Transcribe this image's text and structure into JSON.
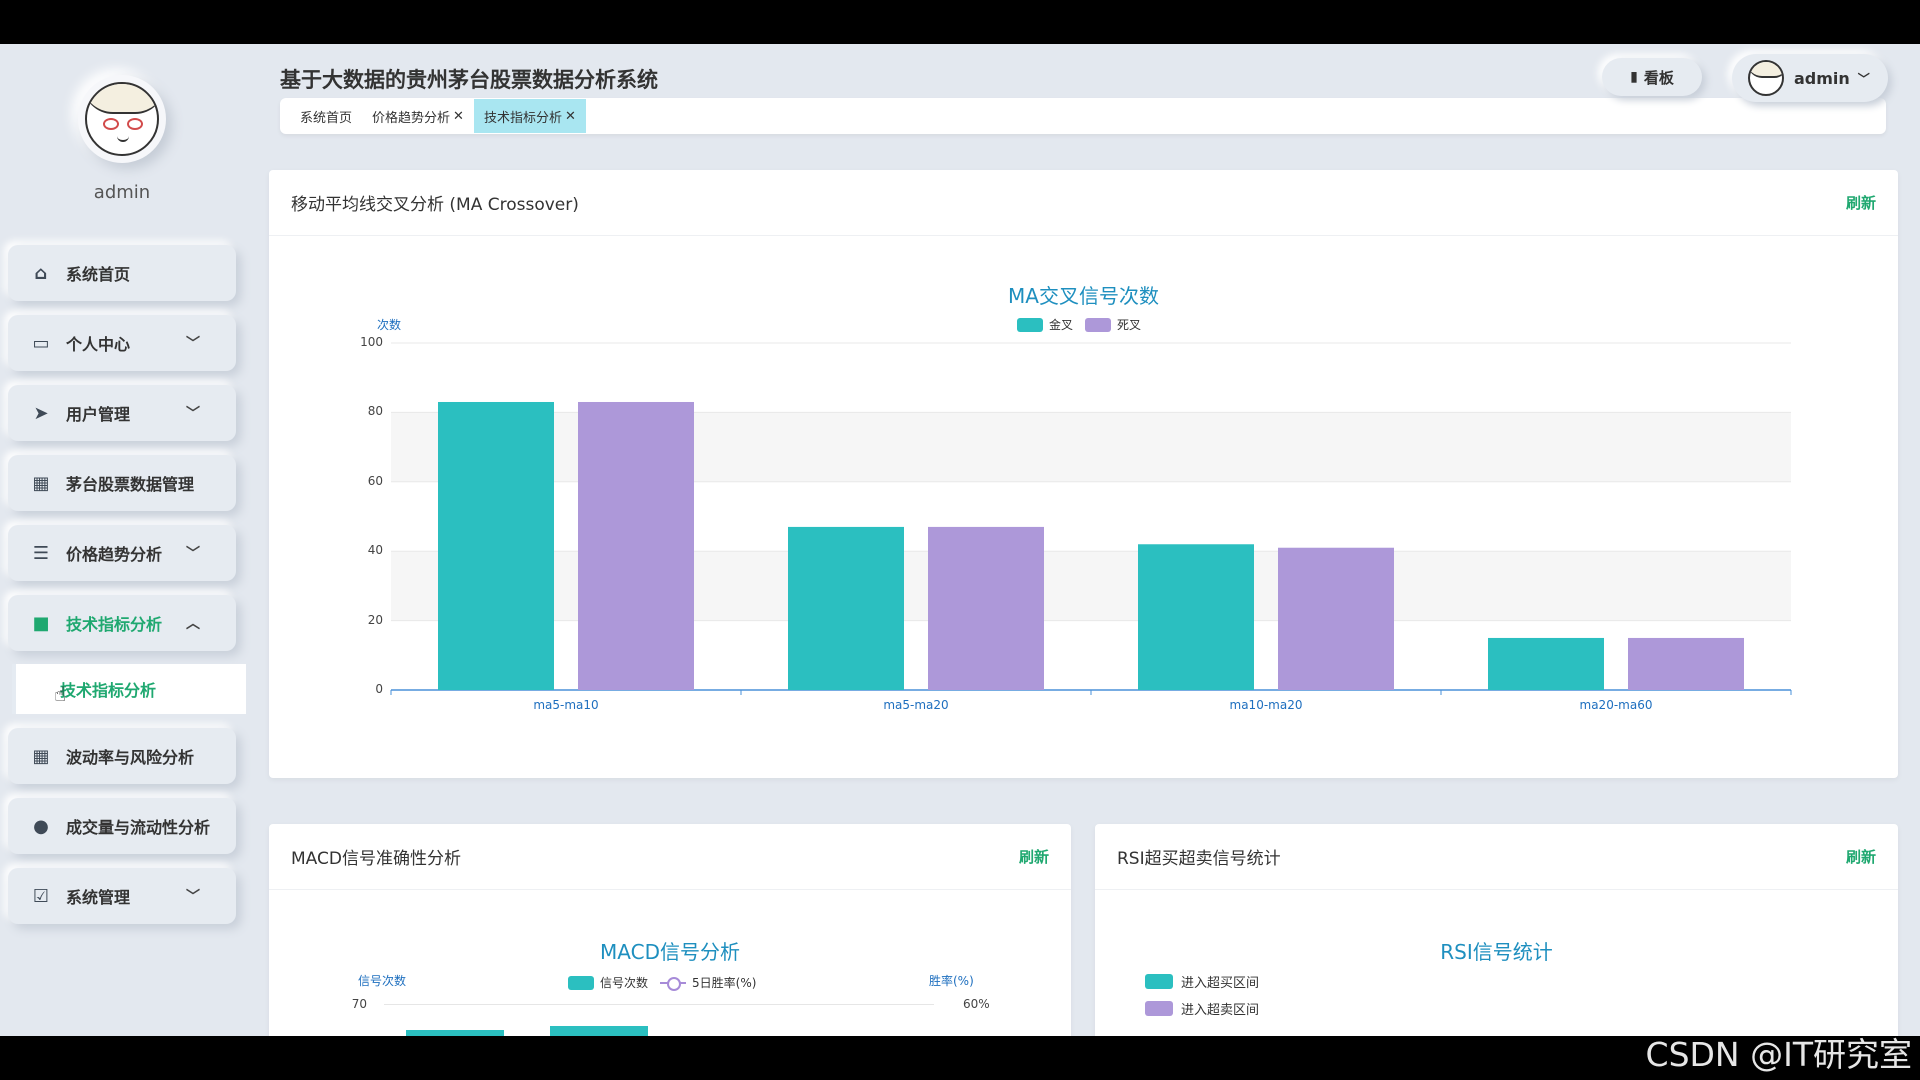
{
  "app": {
    "title": "基于大数据的贵州茅台股票数据分析系统"
  },
  "sidebar": {
    "username": "admin",
    "items": [
      {
        "label": "系统首页",
        "icon": "home-icon",
        "expandable": false
      },
      {
        "label": "个人中心",
        "icon": "id-card-icon",
        "expandable": true
      },
      {
        "label": "用户管理",
        "icon": "send-icon",
        "expandable": true
      },
      {
        "label": "茅台股票数据管理",
        "icon": "grid-icon",
        "expandable": false
      },
      {
        "label": "价格趋势分析",
        "icon": "sliders-icon",
        "expandable": true
      },
      {
        "label": "技术指标分析",
        "icon": "briefcase-icon",
        "expandable": true,
        "expanded": true,
        "active": true
      },
      {
        "label": "波动率与风险分析",
        "icon": "grid-icon",
        "expandable": false
      },
      {
        "label": "成交量与流动性分析",
        "icon": "user-icon",
        "expandable": false
      },
      {
        "label": "系统管理",
        "icon": "clipboard-check-icon",
        "expandable": true
      }
    ],
    "submenu": {
      "label": "技术指标分析"
    }
  },
  "header": {
    "tabs": [
      {
        "label": "系统首页",
        "closable": false
      },
      {
        "label": "价格趋势分析",
        "closable": true
      },
      {
        "label": "技术指标分析",
        "closable": true,
        "active": true
      }
    ],
    "dashboard_label": "看板",
    "user_label": "admin"
  },
  "cards": {
    "ma": {
      "title": "移动平均线交叉分析 (MA Crossover)",
      "refresh": "刷新"
    },
    "macd": {
      "title": "MACD信号准确性分析",
      "refresh": "刷新"
    },
    "rsi": {
      "title": "RSI超买超卖信号统计",
      "refresh": "刷新"
    }
  },
  "chart_data": [
    {
      "type": "bar",
      "title": "MA交叉信号次数",
      "ylabel": "次数",
      "xlabel": "",
      "categories": [
        "ma5-ma10",
        "ma5-ma20",
        "ma10-ma20",
        "ma20-ma60"
      ],
      "series": [
        {
          "name": "金叉",
          "color": "#2bbfc0",
          "values": [
            83,
            47,
            42,
            15
          ]
        },
        {
          "name": "死叉",
          "color": "#ad98d9",
          "values": [
            83,
            47,
            41,
            15
          ]
        }
      ],
      "ylim": [
        0,
        100
      ],
      "yticks": [
        0,
        20,
        40,
        60,
        80,
        100
      ],
      "grid": true,
      "legend": "top-center"
    },
    {
      "type": "bar",
      "title": "MACD信号分析",
      "ylabel": "信号次数",
      "y2label": "胜率(%)",
      "series": [
        {
          "name": "信号次数",
          "color": "#2bbfc0"
        },
        {
          "name": "5日胜率(%)",
          "color": "#a78bd8",
          "type": "line"
        }
      ],
      "visible_yticks": [
        70
      ],
      "visible_y2ticks": [
        "60%"
      ],
      "legend": "top-center"
    },
    {
      "type": "pie",
      "title": "RSI信号统计",
      "series": [
        {
          "name": "进入超买区间",
          "color": "#2bbfc0"
        },
        {
          "name": "进入超卖区间",
          "color": "#ad98d9"
        }
      ],
      "legend": "left"
    }
  ],
  "watermark": "CSDN @IT研究室"
}
